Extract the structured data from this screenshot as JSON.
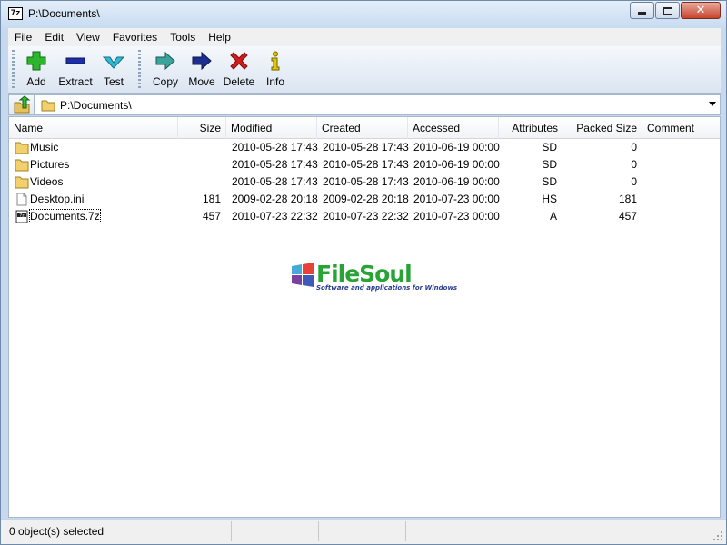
{
  "window": {
    "title": "P:\\Documents\\",
    "app_icon_text": "7z"
  },
  "menu": [
    "File",
    "Edit",
    "View",
    "Favorites",
    "Tools",
    "Help"
  ],
  "toolbar": {
    "add": "Add",
    "extract": "Extract",
    "test": "Test",
    "copy": "Copy",
    "move": "Move",
    "delete": "Delete",
    "info": "Info"
  },
  "address": {
    "path": "P:\\Documents\\"
  },
  "columns": [
    "Name",
    "Size",
    "Modified",
    "Created",
    "Accessed",
    "Attributes",
    "Packed Size",
    "Comment"
  ],
  "files": [
    {
      "icon": "folder-icon",
      "name": "Music",
      "size": "",
      "modified": "2010-05-28 17:43",
      "created": "2010-05-28 17:43",
      "accessed": "2010-06-19 00:00",
      "attributes": "SD",
      "packed": "0",
      "comment": ""
    },
    {
      "icon": "folder-icon",
      "name": "Pictures",
      "size": "",
      "modified": "2010-05-28 17:43",
      "created": "2010-05-28 17:43",
      "accessed": "2010-06-19 00:00",
      "attributes": "SD",
      "packed": "0",
      "comment": ""
    },
    {
      "icon": "folder-icon",
      "name": "Videos",
      "size": "",
      "modified": "2010-05-28 17:43",
      "created": "2010-05-28 17:43",
      "accessed": "2010-06-19 00:00",
      "attributes": "SD",
      "packed": "0",
      "comment": ""
    },
    {
      "icon": "file-icon",
      "name": "Desktop.ini",
      "size": "181",
      "modified": "2009-02-28 20:18",
      "created": "2009-02-28 20:18",
      "accessed": "2010-07-23 00:00",
      "attributes": "HS",
      "packed": "181",
      "comment": ""
    },
    {
      "icon": "archive-icon",
      "name": "Documents.7z",
      "size": "457",
      "modified": "2010-07-23 22:32",
      "created": "2010-07-23 22:32",
      "accessed": "2010-07-23 00:00",
      "attributes": "A",
      "packed": "457",
      "comment": ""
    }
  ],
  "watermark": {
    "name": "FileSoul",
    "tagline": "Software and applications for Windows"
  },
  "status": {
    "selected": "0 object(s) selected",
    "cell2": "",
    "cell3": "",
    "cell4": ""
  },
  "colors": {
    "title_bg": "#c7dbf1",
    "close": "#c7442d",
    "add": "#2db52d",
    "extract": "#1c2fa8",
    "test": "#35b8d4",
    "move": "#1c2f8f",
    "delete": "#d21d1d",
    "info": "#e2c800"
  }
}
